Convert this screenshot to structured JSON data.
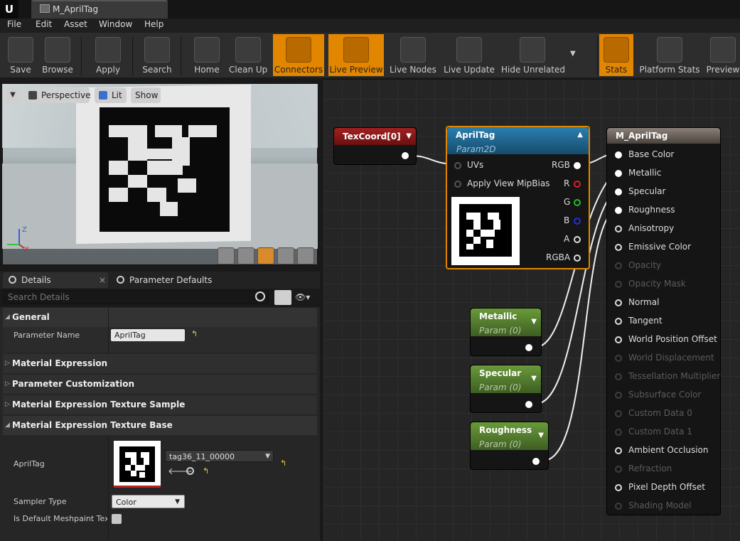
{
  "window": {
    "app_logo": "U",
    "tab_title": "M_AprilTag"
  },
  "menu": [
    "File",
    "Edit",
    "Asset",
    "Window",
    "Help"
  ],
  "toolbar": [
    {
      "label": "Save",
      "icon": "save-icon",
      "active": false
    },
    {
      "label": "Browse",
      "icon": "browse-icon",
      "active": false
    },
    {
      "label": "Apply",
      "icon": "apply-icon",
      "active": false
    },
    {
      "label": "Search",
      "icon": "search-icon",
      "active": false
    },
    {
      "label": "Home",
      "icon": "home-icon",
      "active": false
    },
    {
      "label": "Clean Up",
      "icon": "clean-up-icon",
      "active": false
    },
    {
      "label": "Connectors",
      "icon": "connectors-icon",
      "active": true
    },
    {
      "label": "Live Preview",
      "icon": "live-preview-icon",
      "active": true
    },
    {
      "label": "Live Nodes",
      "icon": "live-nodes-icon",
      "active": false
    },
    {
      "label": "Live Update",
      "icon": "live-update-icon",
      "active": false
    },
    {
      "label": "Hide Unrelated",
      "icon": "hide-unrelated-icon",
      "active": false
    },
    {
      "label": "Stats",
      "icon": "stats-icon",
      "active": true
    },
    {
      "label": "Platform Stats",
      "icon": "platform-stats-icon",
      "active": false
    },
    {
      "label": "Preview",
      "icon": "preview-icon",
      "active": false
    }
  ],
  "viewport": {
    "perspective": "Perspective",
    "lit": "Lit",
    "show": "Show",
    "axis_z": "Z",
    "axis_x": "X"
  },
  "panel": {
    "tab_details": "Details",
    "tab_params": "Parameter Defaults",
    "search_placeholder": "Search Details",
    "categories": {
      "general": "General",
      "mat_expr": "Material Expression",
      "param_custom": "Parameter Customization",
      "tex_sample": "Material Expression Texture Sample",
      "tex_base": "Material Expression Texture Base"
    },
    "param_name_label": "Parameter Name",
    "param_name_value": "AprilTag",
    "apriltag_label": "AprilTag",
    "texture_value": "tag36_11_00000",
    "sampler_label": "Sampler Type",
    "sampler_value": "Color",
    "meshpaint_label": "Is Default Meshpaint Texture"
  },
  "graph": {
    "texcoord": {
      "title": "TexCoord[0]"
    },
    "apriltag": {
      "title": "AprilTag",
      "subtitle": "Param2D",
      "inputs": [
        "UVs",
        "Apply View MipBias"
      ],
      "outputs": [
        "RGB",
        "R",
        "G",
        "B",
        "A",
        "RGBA"
      ]
    },
    "metallic": {
      "title": "Metallic",
      "subtitle": "Param (0)"
    },
    "specular": {
      "title": "Specular",
      "subtitle": "Param (0)"
    },
    "roughness": {
      "title": "Roughness",
      "subtitle": "Param (0)"
    },
    "result": {
      "title": "M_AprilTag",
      "pins": [
        {
          "label": "Base Color",
          "state": "connected"
        },
        {
          "label": "Metallic",
          "state": "connected"
        },
        {
          "label": "Specular",
          "state": "connected"
        },
        {
          "label": "Roughness",
          "state": "connected"
        },
        {
          "label": "Anisotropy",
          "state": "active"
        },
        {
          "label": "Emissive Color",
          "state": "active"
        },
        {
          "label": "Opacity",
          "state": "disabled"
        },
        {
          "label": "Opacity Mask",
          "state": "disabled"
        },
        {
          "label": "Normal",
          "state": "active"
        },
        {
          "label": "Tangent",
          "state": "active"
        },
        {
          "label": "World Position Offset",
          "state": "active"
        },
        {
          "label": "World Displacement",
          "state": "disabled"
        },
        {
          "label": "Tessellation Multiplier",
          "state": "disabled"
        },
        {
          "label": "Subsurface Color",
          "state": "disabled"
        },
        {
          "label": "Custom Data 0",
          "state": "disabled"
        },
        {
          "label": "Custom Data 1",
          "state": "disabled"
        },
        {
          "label": "Ambient Occlusion",
          "state": "active"
        },
        {
          "label": "Refraction",
          "state": "disabled"
        },
        {
          "label": "Pixel Depth Offset",
          "state": "active"
        },
        {
          "label": "Shading Model",
          "state": "disabled"
        }
      ]
    }
  },
  "colors": {
    "accent": "#e28600",
    "texcoord_head": "#7a1414",
    "param2d_head": "#1a5f8a",
    "scalar_head": "#5f8a32",
    "result_head": "#6a625a"
  }
}
